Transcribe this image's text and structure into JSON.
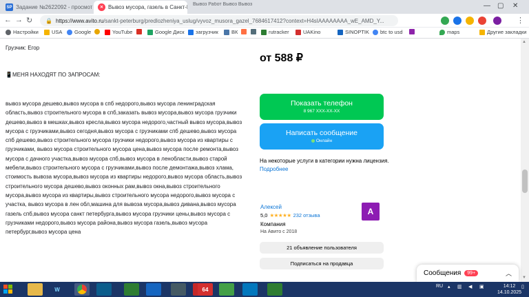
{
  "browser": {
    "tabs": [
      {
        "title": "Задание №2622092 - просмотр з",
        "icon": "sp-logo",
        "active": false
      },
      {
        "title": "Вывоз мусора, газель в Санкт-Пе",
        "icon": "avito-logo",
        "active": true
      }
    ],
    "other_tabs_text": "Вывоз Работ Вывоз Вывоз",
    "url_host": "https://www.avito.ru",
    "url_path": "/sankt-peterburg/predlozheniya_uslug/vyvoz_musora_gazel_7684617412?context=H4sIAAAAAAAA_wE_AMD_Y...",
    "bookmarks": [
      {
        "label": "Настройки",
        "icon": "gear-icon",
        "color": "#5f6368"
      },
      {
        "label": "USA",
        "icon": "folder-icon",
        "color": "#f5b400"
      },
      {
        "label": "Google",
        "icon": "google-icon",
        "color": "#4285f4"
      },
      {
        "label": "",
        "icon": "dot-icon",
        "color": "#e8a600"
      },
      {
        "label": "YouTube",
        "icon": "youtube-icon",
        "color": "#ff0000"
      },
      {
        "label": "",
        "icon": "gmail-icon",
        "color": "#d93025"
      },
      {
        "label": "Google Диск",
        "icon": "drive-icon",
        "color": "#1fa463"
      },
      {
        "label": "загрузчик",
        "icon": "download-icon",
        "color": "#1a73e8"
      },
      {
        "label": "ВК",
        "icon": "vk-icon",
        "color": "#4a76a8"
      },
      {
        "label": "",
        "icon": "square-icon",
        "color": "#ff7043"
      },
      {
        "label": "",
        "icon": "square-icon",
        "color": "#546e7a"
      },
      {
        "label": "rutracker",
        "icon": "rutracker-icon",
        "color": "#2e7d32"
      },
      {
        "label": "UAKino",
        "icon": "uakino-icon",
        "color": "#d32f2f"
      },
      {
        "label": "SINOPTIK",
        "icon": "sinoptik-icon",
        "color": "#1565c0"
      },
      {
        "label": "btc to usd",
        "icon": "google-icon",
        "color": "#4285f4"
      },
      {
        "label": "",
        "icon": "square-icon",
        "color": "#8e24aa"
      },
      {
        "label": "maps",
        "icon": "maps-icon",
        "color": "#34a853"
      }
    ],
    "other_bookmarks": "Другие закладки"
  },
  "listing": {
    "gruzchik": "Грузчик: Егор",
    "find_me": "📱МЕНЯ НАХОДЯТ ПО ЗАПРОСАМ:",
    "description": "вывоз мусора дешево,вывоз мусора в спб недорого,вывоз мусора ленинградская область,вывоз строительного мусора в спб,заказать вывоз мусора,вывоз мусора грузчики дешево,вывоз в мешках,вывоз кресла,вывоз мусора недорого,частный вывоз мусора,вывоз мусора с грузчиками,вывоз сегодня,вывоз мусора с грузчиками спб дешево,вывоз мусора спб дешево,вывоз строительного мусора грузчики недорого,вывоз мусора из квартиры с грузчиками, вывоз мусора строительного мусора цена,вывоз мусора после ремонта,вывоз мусора с дачного участка,вывоз мусора спб,вывоз мусора в ленобласти,вывоз старой мебели,вывоз строительного мусора с грузчиками,вывоз после демонтажа,вывоз хлама, стоимость вывоза мусора,вывоз мусора из квартиры недорого,вывоз мусора область,вывоз строительного мусора дешево,вывоз оконных рам,вывоз окна,вывоз строительного мусора,вывоз мусора из квартиры,вывоз строительного мусора недорого,вывоз мусора с участка, вывоз мусора в лен обл,машина для вывоза мусора,вывоз дивана,вывоз мусора газель спб,вывоз мусора санкт петербурга,вывоз мусора грузчики цены,вывоз мусора с грузчиками недорого,вывоз мусора района,вывоз мусора газель,вывоз мусора петербург,вывоз мусора цена"
  },
  "sidebar": {
    "price": "от 588 ₽",
    "phone_button": "Показать телефон",
    "phone_mask": "8 967 XXX-XX-XX",
    "message_button": "Написать сообщение",
    "online": "Онлайн",
    "license_text": "На некоторые услуги в категории нужна лицензия.",
    "license_link": "Подробнее",
    "seller_name": "Алексей",
    "rating": "5,0",
    "stars": "★★★★★",
    "reviews": "232 отзыва",
    "seller_type": "Компания",
    "since": "На Авито с 2018",
    "avatar_letter": "А",
    "listings_button": "21 объявление пользователя",
    "subscribe_button": "Подписаться на продавца"
  },
  "messages_widget": {
    "label": "Сообщения",
    "badge": "99+"
  },
  "taskbar": {
    "lang": "RU",
    "time": "14:12",
    "date": "14.10.2025",
    "app_badge": "64"
  },
  "colors": {
    "avito_green": "#00c853",
    "avito_blue": "#1aa2f4",
    "avatar_purple": "#8d1cb3",
    "link_blue": "#0a74d6",
    "taskbar": "#1b3566"
  }
}
